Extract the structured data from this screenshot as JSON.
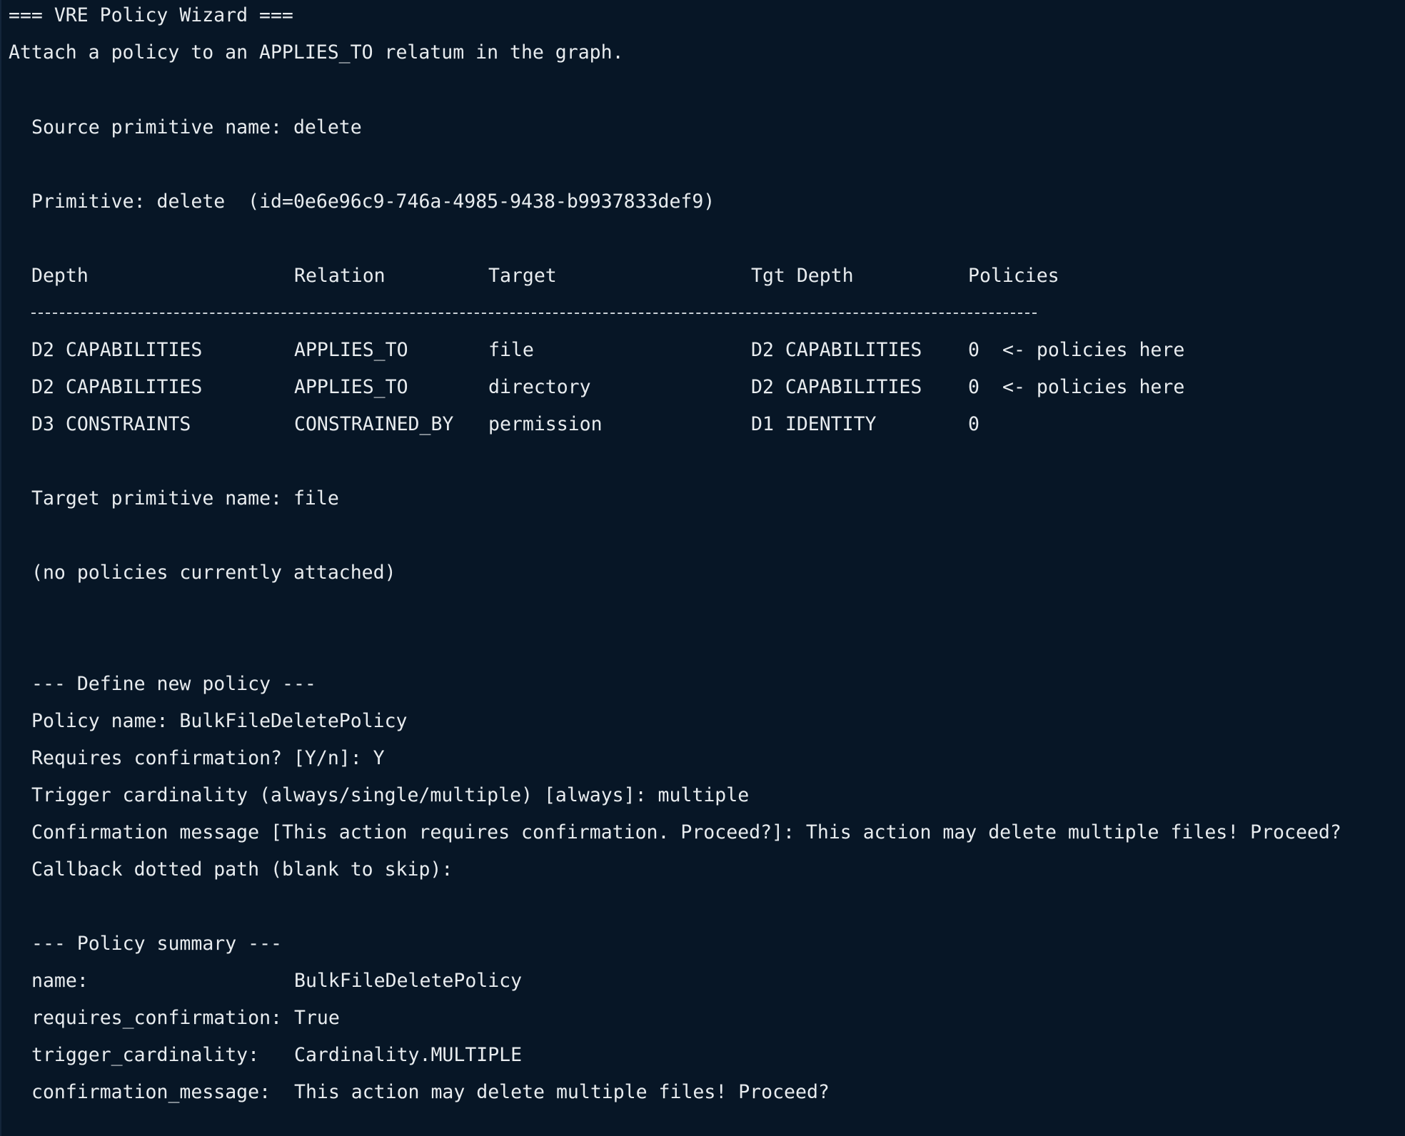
{
  "header": {
    "title": "=== VRE Policy Wizard ===",
    "intro": "Attach a policy to an APPLIES_TO relatum in the graph."
  },
  "source_prompt": {
    "label": "Source primitive name:",
    "value": "delete"
  },
  "primitive_line": "Primitive: delete  (id=0e6e96c9-746a-4985-9438-b9937833def9)",
  "table": {
    "headers": [
      "Depth",
      "Relation",
      "Target",
      "Tgt Depth",
      "Policies"
    ],
    "rows": [
      {
        "depth": "D2 CAPABILITIES",
        "relation": "APPLIES_TO",
        "target": "file",
        "tgt_depth": "D2 CAPABILITIES",
        "policies": "0",
        "note": "<- policies here"
      },
      {
        "depth": "D2 CAPABILITIES",
        "relation": "APPLIES_TO",
        "target": "directory",
        "tgt_depth": "D2 CAPABILITIES",
        "policies": "0",
        "note": "<- policies here"
      },
      {
        "depth": "D3 CONSTRAINTS",
        "relation": "CONSTRAINED_BY",
        "target": "permission",
        "tgt_depth": "D1 IDENTITY",
        "policies": "0",
        "note": ""
      }
    ]
  },
  "target_prompt": {
    "label": "Target primitive name:",
    "value": "file"
  },
  "no_policies": "(no policies currently attached)",
  "define": {
    "heading": "--- Define new policy ---",
    "policy_name_label": "Policy name:",
    "policy_name_value": "BulkFileDeletePolicy",
    "requires_label": "Requires confirmation? [Y/n]:",
    "requires_value": "Y",
    "trigger_label": "Trigger cardinality (always/single/multiple) [always]:",
    "trigger_value": "multiple",
    "message_label": "Confirmation message [This action requires confirmation. Proceed?]:",
    "message_value": "This action may delete multiple files! Proceed?",
    "callback_label": "Callback dotted path (blank to skip):",
    "callback_value": ""
  },
  "summary": {
    "heading": "--- Policy summary ---",
    "rows": [
      {
        "key": "name:",
        "value": "BulkFileDeletePolicy"
      },
      {
        "key": "requires_confirmation:",
        "value": "True"
      },
      {
        "key": "trigger_cardinality:",
        "value": "Cardinality.MULTIPLE"
      },
      {
        "key": "confirmation_message:",
        "value": "This action may delete multiple files! Proceed?"
      }
    ]
  }
}
